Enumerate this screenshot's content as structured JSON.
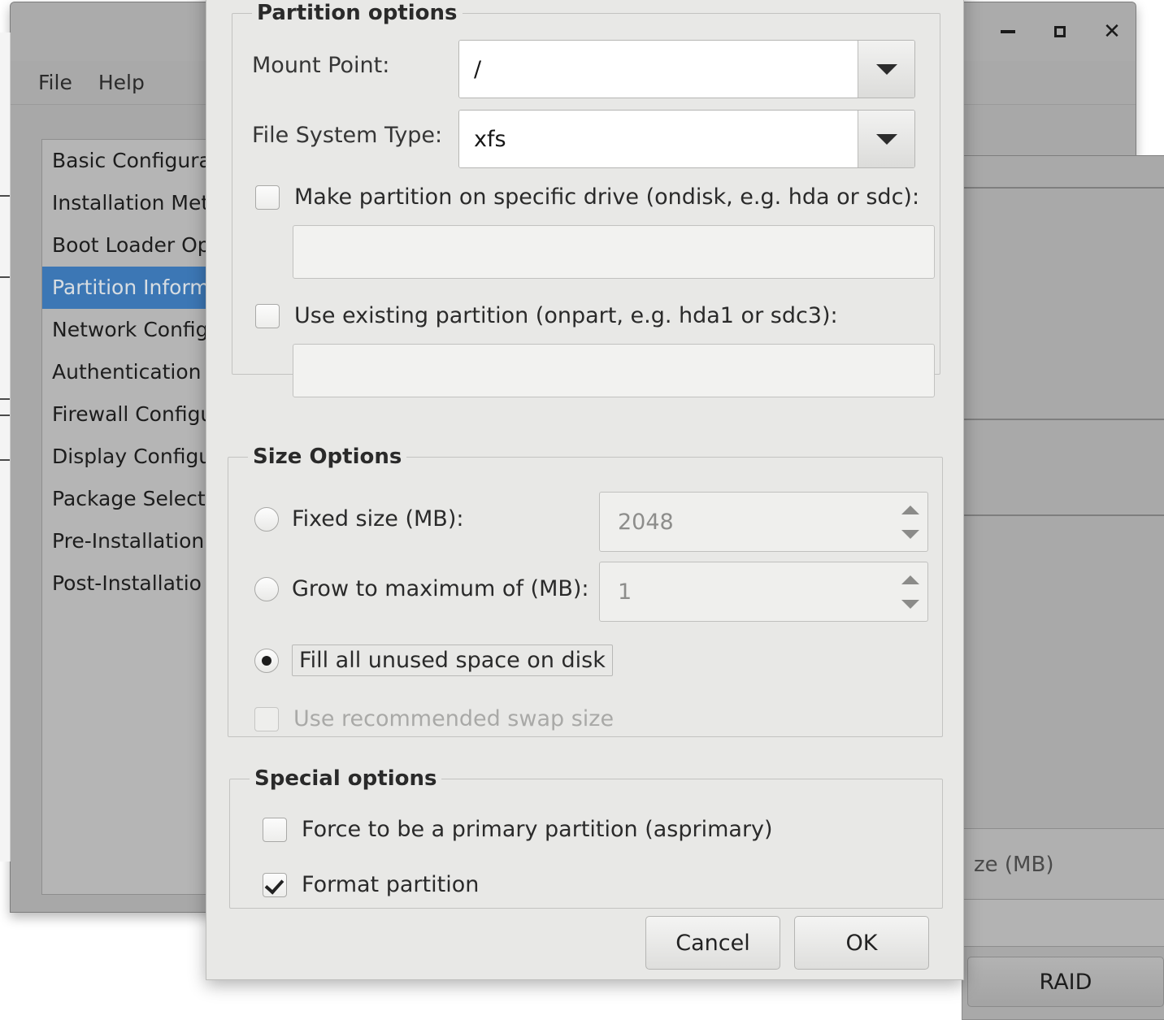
{
  "background_window": {
    "menubar": [
      {
        "label": "File"
      },
      {
        "label": "Help"
      }
    ],
    "window_controls": [
      {
        "name": "minimize",
        "glyph": "minimize-icon"
      },
      {
        "name": "maximize",
        "glyph": "maximize-icon"
      },
      {
        "name": "close",
        "glyph": "close-icon"
      }
    ],
    "nav_items": [
      {
        "label": "Basic Configura",
        "selected": false
      },
      {
        "label": "Installation Met",
        "selected": false
      },
      {
        "label": "Boot Loader Op",
        "selected": false
      },
      {
        "label": "Partition Inform",
        "selected": true
      },
      {
        "label": "Network Config",
        "selected": false
      },
      {
        "label": "Authentication",
        "selected": false
      },
      {
        "label": "Firewall Configu",
        "selected": false
      },
      {
        "label": "Display Configu",
        "selected": false
      },
      {
        "label": "Package Select",
        "selected": false
      },
      {
        "label": "Pre-Installation",
        "selected": false
      },
      {
        "label": "Post-Installatio",
        "selected": false
      }
    ],
    "right_panel": {
      "size_column_label": "ze (MB)",
      "raid_button_label": "RAID"
    }
  },
  "dialog": {
    "partition_options": {
      "legend": "Partition options",
      "mount_point": {
        "label": "Mount Point:",
        "value": "/"
      },
      "file_system_type": {
        "label": "File System Type:",
        "value": "xfs"
      },
      "ondisk": {
        "label": "Make partition on specific drive (ondisk, e.g. hda or sdc):",
        "checked": false,
        "value": ""
      },
      "onpart": {
        "label": "Use existing partition (onpart, e.g. hda1 or sdc3):",
        "checked": false,
        "value": ""
      }
    },
    "size_options": {
      "legend": "Size Options",
      "fixed_size": {
        "label": "Fixed size (MB):",
        "selected": false,
        "value": "2048"
      },
      "grow_to_max": {
        "label": "Grow to maximum of (MB):",
        "selected": false,
        "value": "1"
      },
      "fill_all": {
        "label": "Fill all unused space on disk",
        "selected": true
      },
      "recommended_swap": {
        "label": "Use recommended swap size",
        "checked": false,
        "disabled": true
      }
    },
    "special_options": {
      "legend": "Special options",
      "asprimary": {
        "label": "Force to be a primary partition (asprimary)",
        "checked": false
      },
      "format": {
        "label": "Format partition",
        "checked": true
      }
    },
    "buttons": {
      "cancel": "Cancel",
      "ok": "OK"
    }
  },
  "colors": {
    "selection_blue": "#3c77b5",
    "dialog_bg": "#e8e8e6",
    "window_bg": "#a8a8a8"
  }
}
